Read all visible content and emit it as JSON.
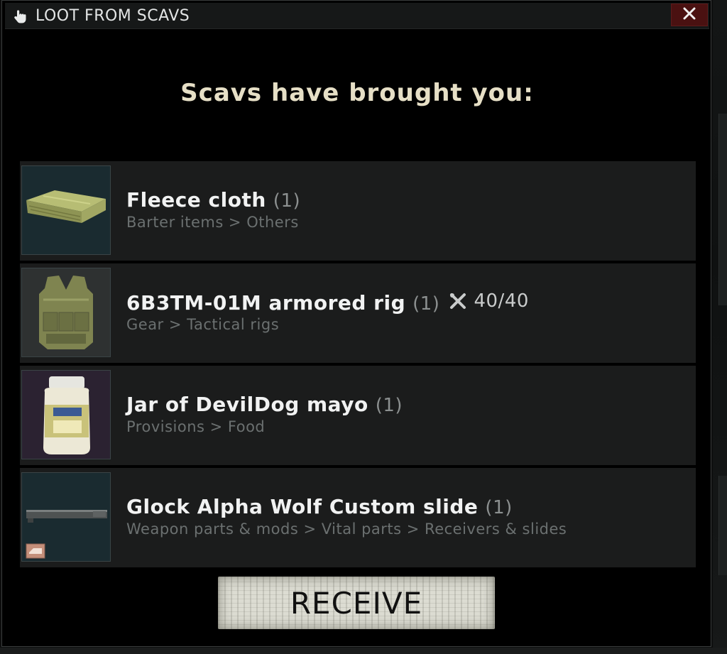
{
  "window": {
    "title": "LOOT FROM SCAVS",
    "title_icon": "hand-pointer-icon",
    "close_icon": "close-icon"
  },
  "heading": "Scavs have brought you:",
  "items": [
    {
      "name": "Fleece cloth",
      "count": "(1)",
      "category": "Barter items > Others",
      "icon": "fleece-cloth-icon"
    },
    {
      "name": "6B3TM-01M armored rig",
      "count": "(1)",
      "durability": "40/40",
      "durability_icon": "repair-tools-icon",
      "category": "Gear > Tactical rigs",
      "icon": "armored-rig-icon"
    },
    {
      "name": "Jar of DevilDog mayo",
      "count": "(1)",
      "category": "Provisions > Food",
      "icon": "mayo-jar-icon"
    },
    {
      "name": "Glock Alpha Wolf Custom slide",
      "count": "(1)",
      "category": "Weapon parts & mods > Vital parts > Receivers & slides",
      "icon": "pistol-slide-icon"
    }
  ],
  "receive_button": "RECEIVE",
  "colors": {
    "window_bg": "#000000",
    "row_bg": "#1b1c1c",
    "heading": "#e6dfc6",
    "close_bg": "#4a1111"
  }
}
